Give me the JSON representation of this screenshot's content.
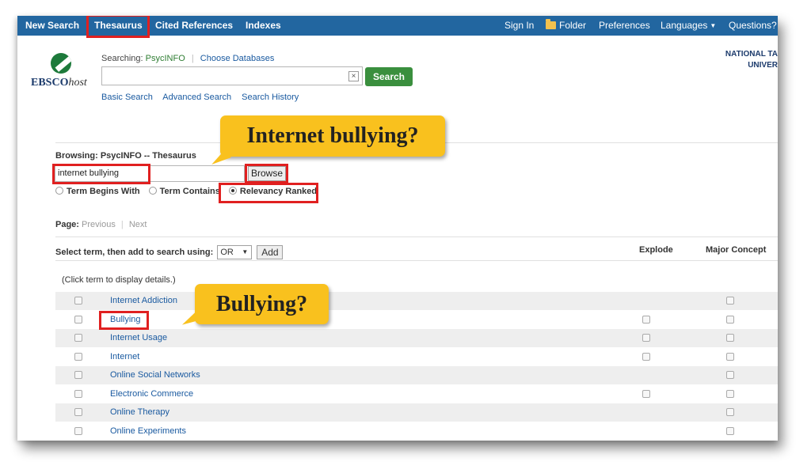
{
  "topnav": {
    "items": [
      "New Search",
      "Thesaurus",
      "Cited References",
      "Indexes"
    ],
    "right": [
      "Sign In",
      "Folder",
      "Preferences",
      "Languages",
      "Questions?"
    ]
  },
  "header": {
    "logo_brand": "EBSCO",
    "logo_suffix": "host",
    "searching_label": "Searching:",
    "database": "PsycINFO",
    "choose_databases": "Choose Databases",
    "search_value": "",
    "clear_icon": "×",
    "search_button": "Search",
    "sublinks": [
      "Basic Search",
      "Advanced Search",
      "Search History"
    ],
    "institution_line1": "NATIONAL TA",
    "institution_line2": "UNIVER"
  },
  "browse": {
    "label": "Browsing: PsycINFO -- Thesaurus",
    "input_value": "internet bullying",
    "button": "Browse",
    "options": [
      "Term Begins With",
      "Term Contains",
      "Relevancy Ranked"
    ],
    "selected_option": "Relevancy Ranked"
  },
  "paging": {
    "label": "Page:",
    "previous": "Previous",
    "next": "Next"
  },
  "select_bar": {
    "label": "Select term, then add to search using:",
    "operator": "OR",
    "add_button": "Add",
    "col_explode": "Explode",
    "col_major": "Major Concept"
  },
  "hint": "(Click term to display details.)",
  "terms": [
    {
      "label": "Internet Addiction",
      "explode": false,
      "major": true
    },
    {
      "label": "Bullying",
      "explode": true,
      "major": true
    },
    {
      "label": "Internet Usage",
      "explode": true,
      "major": true
    },
    {
      "label": "Internet",
      "explode": true,
      "major": true
    },
    {
      "label": "Online Social Networks",
      "explode": false,
      "major": true
    },
    {
      "label": "Electronic Commerce",
      "explode": true,
      "major": true
    },
    {
      "label": "Online Therapy",
      "explode": false,
      "major": true
    },
    {
      "label": "Online Experiments",
      "explode": false,
      "major": true
    }
  ],
  "callouts": {
    "first": "Internet bullying?",
    "second": "Bullying?"
  },
  "colors": {
    "topbar": "#2266a0",
    "highlight": "#e02020",
    "callout": "#f9c11e",
    "link": "#1a5aa0"
  }
}
